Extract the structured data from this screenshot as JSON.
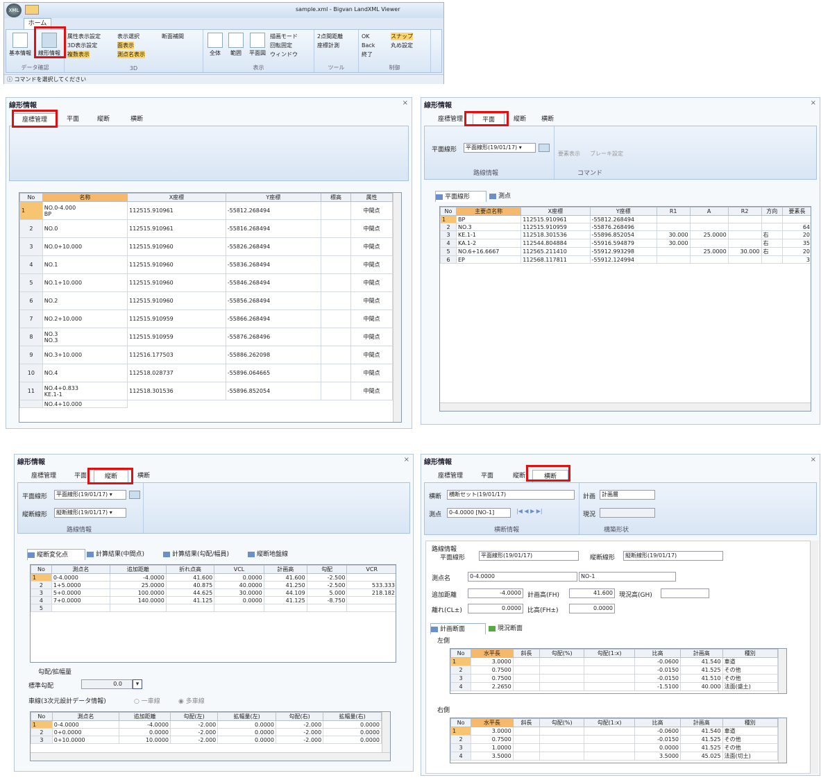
{
  "ribbon": {
    "title": "sample.xml - Bigvan LandXML Viewer",
    "tab": "ホーム",
    "orb": "XML",
    "data_group": "データ確認",
    "data_btns": [
      "基本情報",
      "線形情報"
    ],
    "g3d": "3D",
    "g3d_items": [
      "属性表示設定",
      "3D表示設定",
      "複数表示",
      "表示選択",
      "面表示",
      "測点名表示",
      "断面補間"
    ],
    "disp": "表示",
    "disp_items": [
      "全体",
      "範囲",
      "平面図",
      "描画モード",
      "回転固定",
      "ウィンドウ"
    ],
    "tool": "ツール",
    "tool_items": [
      "2点間距離",
      "座標計測"
    ],
    "ctrl": "制御",
    "ctrl_items": [
      "OK",
      "Back",
      "終了",
      "スナップ",
      "丸め設定"
    ],
    "status": "コマンドを選択してください"
  },
  "common": {
    "panel_title": "線形情報",
    "tabs": [
      "座標管理",
      "平面",
      "縦断",
      "横断"
    ],
    "close": "×"
  },
  "p1": {
    "headers": [
      "No",
      "名称",
      "X座標",
      "Y座標",
      "標高",
      "属性"
    ],
    "rows": [
      [
        "1",
        "NO.0-4.000",
        "BP",
        "112515.910961",
        "-55812.268494",
        "中間点"
      ],
      [
        "2",
        "NO.0",
        "",
        "112515.910961",
        "-55816.268494",
        "中間点"
      ],
      [
        "3",
        "NO.0+10.000",
        "",
        "112515.910960",
        "-55826.268494",
        "中間点"
      ],
      [
        "4",
        "NO.1",
        "",
        "112515.910960",
        "-55836.268494",
        "中間点"
      ],
      [
        "5",
        "NO.1+10.000",
        "",
        "112515.910960",
        "-55846.268494",
        "中間点"
      ],
      [
        "6",
        "NO.2",
        "",
        "112515.910960",
        "-55856.268494",
        "中間点"
      ],
      [
        "7",
        "NO.2+10.000",
        "",
        "112515.910959",
        "-55866.268494",
        "中間点"
      ],
      [
        "8",
        "NO.3",
        "NO.3",
        "112515.910959",
        "-55876.268496",
        "中間点"
      ],
      [
        "9",
        "NO.3+10.000",
        "",
        "112516.177503",
        "-55886.262098",
        "中間点"
      ],
      [
        "10",
        "NO.4",
        "",
        "112518.028737",
        "-55896.064665",
        "中間点"
      ],
      [
        "11",
        "NO.4+0.833",
        "KE.1-1",
        "112518.301536",
        "-55896.852054",
        "中間点"
      ]
    ],
    "partial": "NO.4+10.000"
  },
  "p2": {
    "label_line": "平面線形",
    "combo": "平面線形(19/01/17)",
    "grp1": "路線情報",
    "btn_a": "要素表示",
    "btn_b": "ブレーキ設定",
    "grp2": "コマンド",
    "subtabs": [
      "平面線形",
      "測点"
    ],
    "headers": [
      "No",
      "主要点名称",
      "X座標",
      "Y座標",
      "R1",
      "A",
      "R2",
      "方向",
      "要素長"
    ],
    "rows": [
      [
        "1",
        "BP",
        "112515.910961",
        "-55812.268494",
        "",
        "",
        "",
        "",
        ""
      ],
      [
        "2",
        "NO.3",
        "112515.910959",
        "-55876.268496",
        "",
        "",
        "",
        "",
        "64"
      ],
      [
        "3",
        "KE.1-1",
        "112518.301536",
        "-55896.852054",
        "30.000",
        "25.0000",
        "",
        "右",
        "20"
      ],
      [
        "4",
        "KA.1-2",
        "112544.804884",
        "-55916.594879",
        "30.000",
        "",
        "",
        "右",
        "35"
      ],
      [
        "5",
        "NO.6+16.6667",
        "112565.211410",
        "-55912.993298",
        "",
        "25.0000",
        "30.000",
        "右",
        "20"
      ],
      [
        "6",
        "EP",
        "112568.117811",
        "-55912.124994",
        "",
        "",
        "",
        "",
        "3"
      ]
    ]
  },
  "p3": {
    "label_h": "平面線形",
    "combo_h": "平面線形(19/01/17)",
    "label_v": "縦断線形",
    "combo_v": "縦断線形(19/01/17)",
    "grp": "路線情報",
    "subtabs": [
      "縦断変化点",
      "計算結果(中間点)",
      "計算結果(勾配/幅員)",
      "縦断地盤線"
    ],
    "headers": [
      "No",
      "測点名",
      "追加距離",
      "折れ点高",
      "VCL",
      "計画高",
      "勾配",
      "VCR"
    ],
    "rows": [
      [
        "1",
        "0-4.0000",
        "-4.0000",
        "41.600",
        "0.0000",
        "41.600",
        "-2.500",
        ""
      ],
      [
        "2",
        "1+5.0000",
        "25.0000",
        "40.875",
        "40.0000",
        "41.250",
        "-2.500",
        "533.333"
      ],
      [
        "3",
        "5+0.0000",
        "100.0000",
        "44.625",
        "30.0000",
        "44.109",
        "5.000",
        "218.182"
      ],
      [
        "4",
        "7+0.0000",
        "140.0000",
        "41.125",
        "0.0000",
        "41.125",
        "-8.750",
        ""
      ],
      [
        "5",
        "",
        "",
        "",
        "",
        "",
        "",
        ""
      ]
    ],
    "slope_title": "勾配/拡幅量",
    "std_label": "標準勾配",
    "std_val": "0.0",
    "lane_label": "車線(3次元設計データ情報)",
    "r1": "一車線",
    "r2": "多車線",
    "headers2": [
      "No",
      "測点名",
      "追加距離",
      "勾配(左)",
      "拡幅量(左)",
      "勾配(右)",
      "拡幅量(右)"
    ],
    "rows2": [
      [
        "1",
        "0-4.0000",
        "-4.0000",
        "-2.000",
        "0.0000",
        "-2.000",
        "0.0000"
      ],
      [
        "2",
        "0+0.0000",
        "0.0000",
        "-2.000",
        "0.0000",
        "-2.000",
        "0.0000"
      ],
      [
        "3",
        "0+10.0000",
        "10.0000",
        "-2.000",
        "0.0000",
        "-2.000",
        "0.0000"
      ]
    ]
  },
  "p4": {
    "l_cross": "横断",
    "c_cross": "横断セット(19/01/17)",
    "l_plan": "計画",
    "c_plan": "計画層",
    "l_pt": "測点",
    "c_pt": "0-4.0000 [NO-1]",
    "l_now": "現況",
    "g1": "横断情報",
    "g2": "構築形状",
    "route": "路線情報",
    "l_h": "平面線形",
    "v_h": "平面線形(19/01/17)",
    "l_v": "縦断線形",
    "v_v": "縦断線形(19/01/17)",
    "l_name": "測点名",
    "v_name": "0-4.0000",
    "v_no": "NO-1",
    "l_dist": "追加距離",
    "v_dist": "-4.0000",
    "l_fh": "計画高(FH)",
    "v_fh": "41.600",
    "l_gh": "現況高(GH)",
    "l_cl": "離れ(CL±)",
    "v_cl": "0.0000",
    "l_rate": "比高(FH±)",
    "v_rate": "0.0000",
    "subtabs": [
      "計画断面",
      "現況断面"
    ],
    "left": "左側",
    "right": "右側",
    "headers": [
      "No",
      "水平長",
      "斜長",
      "勾配(%)",
      "勾配(1:x)",
      "比高",
      "計画高",
      "種別"
    ],
    "lrows": [
      [
        "1",
        "3.0000",
        "",
        "",
        "",
        "-0.0600",
        "41.540",
        "車道"
      ],
      [
        "2",
        "0.7500",
        "",
        "",
        "",
        "-0.0150",
        "41.525",
        "その他"
      ],
      [
        "3",
        "0.7500",
        "",
        "",
        "",
        "-0.0150",
        "41.510",
        "その他"
      ],
      [
        "4",
        "2.2650",
        "",
        "",
        "",
        "-1.5100",
        "40.000",
        "法面(盛土)"
      ]
    ],
    "rrows": [
      [
        "1",
        "3.0000",
        "",
        "",
        "",
        "-0.0600",
        "41.540",
        "車道"
      ],
      [
        "2",
        "0.7500",
        "",
        "",
        "",
        "-0.0150",
        "41.525",
        "その他"
      ],
      [
        "3",
        "1.0000",
        "",
        "",
        "",
        "0.0000",
        "41.525",
        "その他"
      ],
      [
        "4",
        "3.5000",
        "",
        "",
        "",
        "3.5000",
        "45.025",
        "法面(切土)"
      ]
    ]
  }
}
